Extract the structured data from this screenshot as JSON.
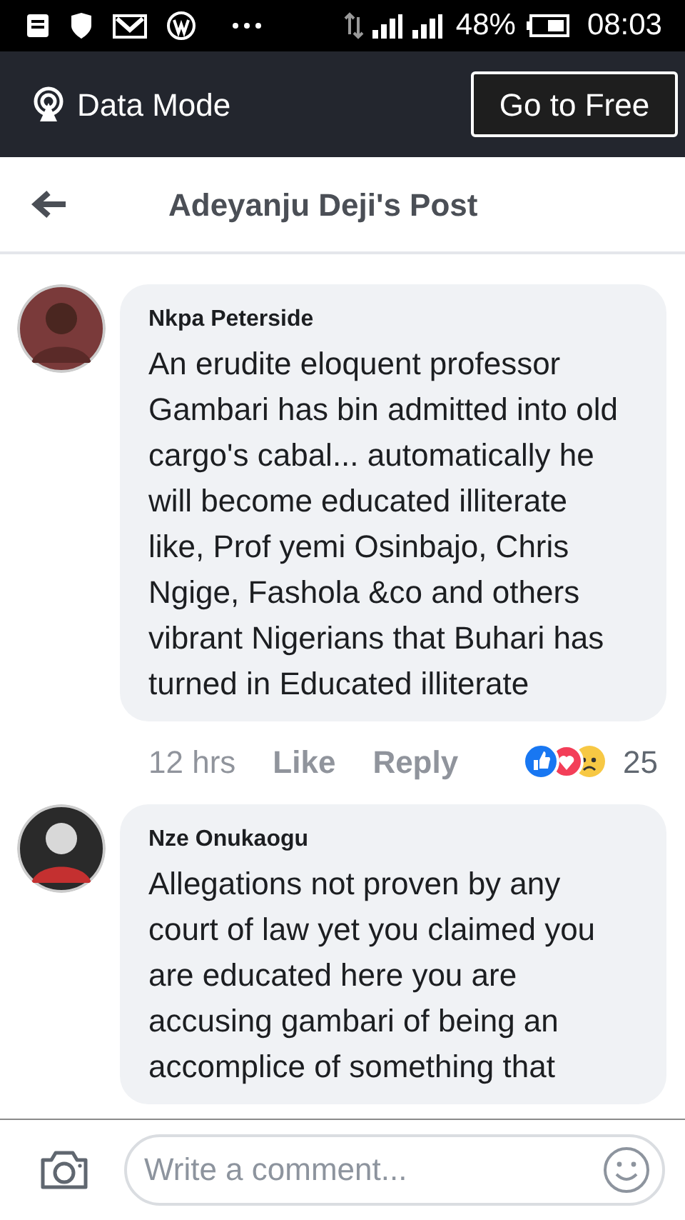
{
  "status_bar": {
    "battery": "48%",
    "time": "08:03"
  },
  "data_banner": {
    "label": "Data Mode",
    "button": "Go to Free"
  },
  "header": {
    "title": "Adeyanju Deji's Post"
  },
  "comments": [
    {
      "author": "Nkpa Peterside",
      "text": "An erudite eloquent professor Gambari has bin admitted into old cargo's cabal... automatically he will become educated illiterate like, Prof yemi Osinbajo, Chris Ngige, Fashola &co and others vibrant Nigerians that Buhari has turned in Educated illiterate",
      "time": "12 hrs",
      "like": "Like",
      "reply": "Reply",
      "reaction_count": "25"
    },
    {
      "author": "Nze Onukaogu",
      "text": "Allegations not proven by any court of law yet you claimed you are educated here you are accusing gambari of being an accomplice of something that"
    }
  ],
  "composer": {
    "placeholder": "Write a comment..."
  }
}
